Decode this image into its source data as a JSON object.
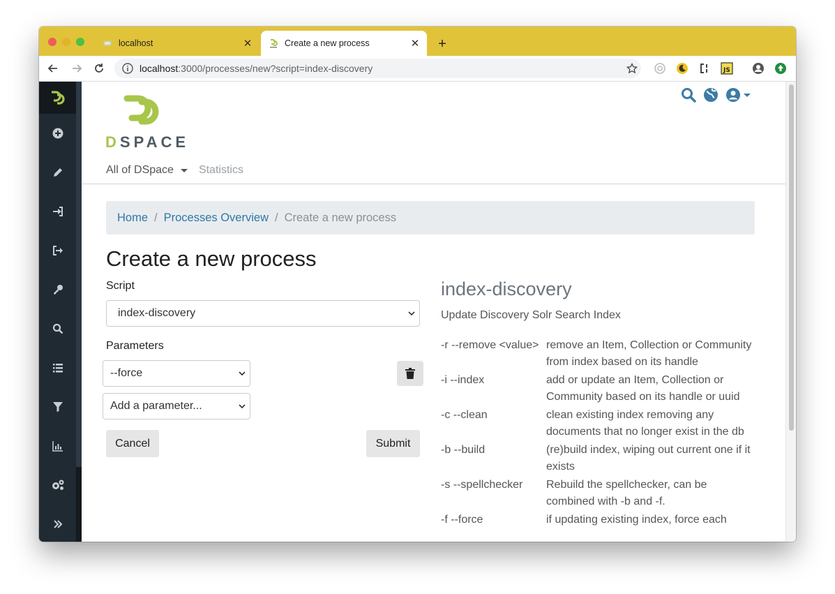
{
  "browser": {
    "tabs": [
      {
        "title": "localhost",
        "active": false
      },
      {
        "title": "Create a new process",
        "active": true
      }
    ],
    "url_host": "localhost",
    "url_rest": ":3000/processes/new?script=index-discovery"
  },
  "header": {
    "brand": "DSPACE",
    "brand_first": "D",
    "brand_rest": "SPACE",
    "nav": [
      {
        "label": "All of DSpace",
        "has_dropdown": true
      },
      {
        "label": "Statistics"
      }
    ]
  },
  "breadcrumb": {
    "items": [
      "Home",
      "Processes Overview",
      "Create a new process"
    ]
  },
  "page": {
    "title": "Create a new process",
    "script_label": "Script",
    "script_value": "index-discovery",
    "parameters_label": "Parameters",
    "param_selected": "--force",
    "param_placeholder": "Add a parameter...",
    "cancel_label": "Cancel",
    "submit_label": "Submit"
  },
  "script_info": {
    "name": "index-discovery",
    "description": "Update Discovery Solr Search Index",
    "parameters": [
      {
        "name": "-r --remove <value>",
        "desc": "remove an Item, Collection or Community from index based on its handle"
      },
      {
        "name": "-i --index",
        "desc": "add or update an Item, Collection or Community based on its handle or uuid"
      },
      {
        "name": "-c --clean",
        "desc": "clean existing index removing any documents that no longer exist in the db"
      },
      {
        "name": "-b --build",
        "desc": "(re)build index, wiping out current one if it exists"
      },
      {
        "name": "-s --spellchecker",
        "desc": "Rebuild the spellchecker, can be combined with -b and -f."
      },
      {
        "name": "-f --force",
        "desc": "if updating existing index, force each"
      }
    ]
  },
  "colors": {
    "tab_strip": "#e1c33a",
    "sidebar": "#1f2a33",
    "dspace_green": "#a7c64a",
    "link": "#2e78a6"
  }
}
